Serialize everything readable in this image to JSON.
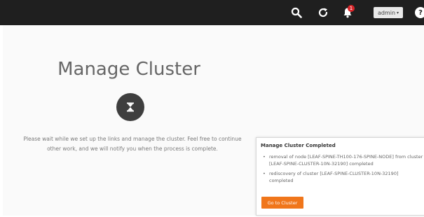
{
  "header": {
    "icons": [
      "search-icon",
      "refresh-icon",
      "bell-icon",
      "help-icon"
    ],
    "notification_count": "1",
    "user_label": "admin",
    "help_symbol": "?",
    "background_color": "#1f1f1f"
  },
  "main": {
    "title": "Manage Cluster",
    "status_icon": "hourglass-icon",
    "message_line1": "Please wait while we set up the links and manage the cluster. Feel free to continue",
    "message_line2": "other work, and we will notify you when the process is complete."
  },
  "notification_panel": {
    "title": "Manage Cluster Completed",
    "items": [
      "removal of node [LEAF-SPINE-TH100-176-SPINE-NODE] from cluster [LEAF-SPINE-CLUSTER-10N-32190] completed",
      "rediscovery of cluster [LEAF-SPINE-CLUSTER-10N-32190] completed"
    ],
    "button_label": "Go to Cluster",
    "button_color": "#f0761b"
  }
}
